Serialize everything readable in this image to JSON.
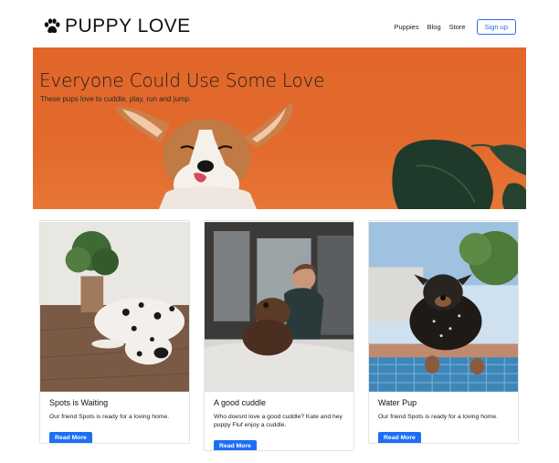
{
  "header": {
    "brand": "PUPPY LOVE",
    "nav": [
      "Puppies",
      "Blog",
      "Store"
    ],
    "signup": "Sign up"
  },
  "hero": {
    "title": "Everyone Could Use Some Love",
    "subtitle": "These pups love to cuddle, play, run and jump."
  },
  "cards": [
    {
      "title": "Spots is Waiting",
      "text": "Our friend Spots is ready for a loving home.",
      "button": "Read More"
    },
    {
      "title": "A good cuddle",
      "text": "Who doesnt love a good cuddle? Kate and hey puppy Fluf enjoy a cuddle.",
      "button": "Read More"
    },
    {
      "title": "Water Pup",
      "text": "Our friend Spots is ready for a loving home.",
      "button": "Read More"
    }
  ],
  "colors": {
    "accent": "#1d6ef5",
    "hero_bg": "#e2662a"
  },
  "icons": [
    "paw-icon"
  ]
}
